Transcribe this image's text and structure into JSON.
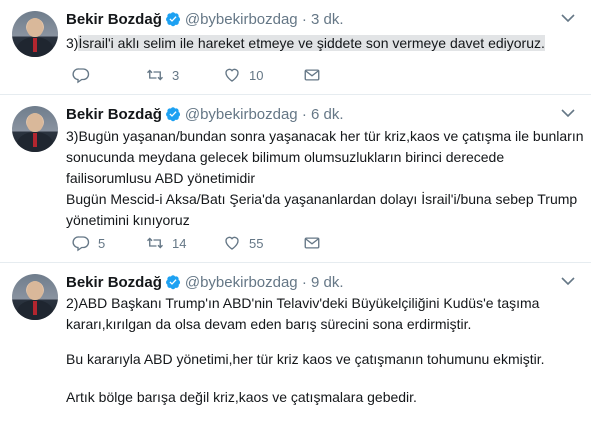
{
  "tweets": [
    {
      "name": "Bekir Bozdağ",
      "handle": "@bybekirbozdag",
      "time": "· 3 dk.",
      "text_prefix": "3)",
      "text_highlight": "İsrail'i aklı selim ile hareket etmeye ve şiddete son vermeye davet ediyoruz.",
      "replies": "",
      "retweets": "3",
      "likes": "10"
    },
    {
      "name": "Bekir Bozdağ",
      "handle": "@bybekirbozdag",
      "time": "· 6 dk.",
      "lines": [
        "3)Bugün yaşanan/bundan sonra yaşanacak her tür kriz,kaos ve çatışma ile bunların",
        "sonucunda meydana gelecek bilimum olumsuzlukların birinci derecede",
        "failisorumlusu ABD yönetimidir",
        "Bugün Mescid-i Aksa/Batı Şeria'da yaşananlardan dolayı İsrail'i/buna sebep Trump",
        "yönetimini kınıyoruz"
      ],
      "replies": "5",
      "retweets": "14",
      "likes": "55"
    },
    {
      "name": "Bekir Bozdağ",
      "handle": "@bybekirbozdag",
      "time": "· 9 dk.",
      "lines": [
        "2)ABD Başkanı Trump'ın ABD'nin Telaviv'deki Büyükelçiliğini Kudüs'e taşıma",
        "kararı,kırılgan da olsa devam eden barış sürecini sona erdirmiştir.",
        "Bu kararıyla ABD yönetimi,her tür kriz kaos ve çatışmanın tohumunu ekmiştir.",
        "Artık bölge barışa değil kriz,kaos ve çatışmalara gebedir."
      ]
    }
  ],
  "colors": {
    "verified": "#1da1f2",
    "icon": "#657786",
    "highlight": "#e2e4e6"
  }
}
